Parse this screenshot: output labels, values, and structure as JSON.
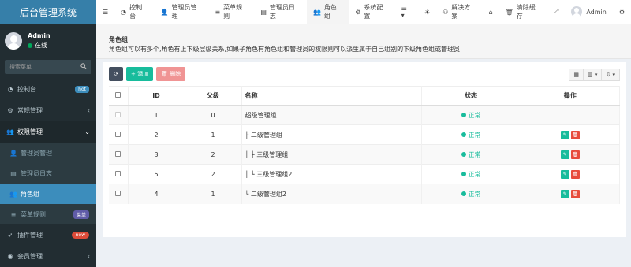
{
  "app": {
    "title": "后台管理系统"
  },
  "user": {
    "name": "Admin",
    "status": "在线"
  },
  "search": {
    "placeholder": "搜索菜单"
  },
  "sidebar": {
    "items": [
      {
        "label": "控制台",
        "icon": "dashboard-icon",
        "badge": "hot"
      },
      {
        "label": "常规管理",
        "icon": "cogs-icon",
        "arrow": "‹"
      },
      {
        "label": "权限管理",
        "icon": "group-icon",
        "arrow": "⌄"
      },
      {
        "label": "管理员管理",
        "icon": "user-icon"
      },
      {
        "label": "管理员日志",
        "icon": "list-alt-icon"
      },
      {
        "label": "角色组",
        "icon": "group-icon"
      },
      {
        "label": "菜单规则",
        "icon": "bars-icon",
        "badge": "菜单"
      },
      {
        "label": "插件管理",
        "icon": "rocket-icon",
        "badge": "new"
      },
      {
        "label": "会员管理",
        "icon": "user-circle-icon",
        "arrow": "‹"
      }
    ]
  },
  "topnav": {
    "tabs": [
      {
        "label": "控制台",
        "icon": "dashboard-icon"
      },
      {
        "label": "管理员管理",
        "icon": "user-icon"
      },
      {
        "label": "菜单规则",
        "icon": "bars-icon"
      },
      {
        "label": "管理员日志",
        "icon": "list-alt-icon"
      },
      {
        "label": "角色组",
        "icon": "group-icon"
      },
      {
        "label": "系统配置",
        "icon": "cog-icon"
      }
    ],
    "solution": "解决方案",
    "clear_cache": "清除缓存",
    "user": "Admin"
  },
  "page": {
    "title": "角色组",
    "description": "角色组可以有多个,角色有上下级层级关系,如果子角色有角色组和管理员的权限则可以派生属于自己组别的下级角色组或管理员"
  },
  "toolbar": {
    "add": "添加",
    "delete": "删除"
  },
  "table": {
    "headers": {
      "id": "ID",
      "parent": "父级",
      "name": "名称",
      "status": "状态",
      "operate": "操作"
    },
    "rows": [
      {
        "id": "1",
        "parent": "0",
        "name": "超级管理组",
        "status": "正常",
        "checkbox_disabled": true,
        "ops": false
      },
      {
        "id": "2",
        "parent": "1",
        "name": "├ 二级管理组",
        "status": "正常",
        "checkbox_disabled": false,
        "ops": true
      },
      {
        "id": "3",
        "parent": "2",
        "name": "│ ├ 三级管理组",
        "status": "正常",
        "checkbox_disabled": false,
        "ops": true
      },
      {
        "id": "5",
        "parent": "2",
        "name": "│ └ 三级管理组2",
        "status": "正常",
        "checkbox_disabled": false,
        "ops": true
      },
      {
        "id": "4",
        "parent": "1",
        "name": "└ 二级管理组2",
        "status": "正常",
        "checkbox_disabled": false,
        "ops": true
      }
    ]
  }
}
